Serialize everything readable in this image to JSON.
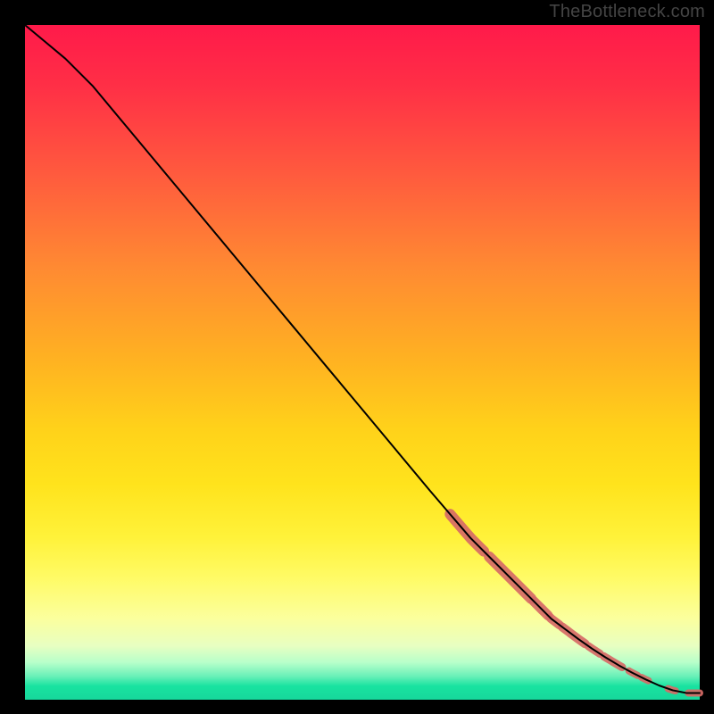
{
  "watermark": "TheBottleneck.com",
  "colors": {
    "background": "#000000",
    "curve": "#000000",
    "highlight": "#d66a66"
  },
  "chart_data": {
    "type": "line",
    "title": "",
    "xlabel": "",
    "ylabel": "",
    "xlim": [
      0,
      100
    ],
    "ylim": [
      0,
      100
    ],
    "grid": false,
    "legend": false,
    "series": [
      {
        "name": "bottleneck-curve",
        "x": [
          0,
          3,
          6,
          10,
          15,
          20,
          25,
          30,
          35,
          40,
          45,
          50,
          55,
          60,
          63,
          66,
          69,
          72,
          75,
          78,
          80,
          82,
          84,
          86,
          88,
          90,
          92,
          94,
          96,
          98,
          100
        ],
        "y": [
          100,
          97.5,
          95,
          91,
          85,
          79,
          73,
          67,
          61,
          55,
          49,
          43,
          37,
          31,
          27.5,
          24,
          21,
          18,
          15,
          12,
          10.5,
          9,
          7.6,
          6.3,
          5.1,
          4.0,
          3.0,
          2.1,
          1.4,
          1.0,
          1.0
        ]
      }
    ],
    "highlight_segments": [
      {
        "x0": 63,
        "x1": 68,
        "thickness": 12
      },
      {
        "x0": 68.8,
        "x1": 75,
        "thickness": 12
      },
      {
        "x0": 75.4,
        "x1": 77.5,
        "thickness": 11
      },
      {
        "x0": 77.8,
        "x1": 79.2,
        "thickness": 10
      },
      {
        "x0": 79.6,
        "x1": 83.0,
        "thickness": 10
      },
      {
        "x0": 83.5,
        "x1": 85.2,
        "thickness": 9
      },
      {
        "x0": 85.8,
        "x1": 88.5,
        "thickness": 9
      },
      {
        "x0": 89.5,
        "x1": 90.8,
        "thickness": 8
      },
      {
        "x0": 91.4,
        "x1": 92.4,
        "thickness": 8
      },
      {
        "x0": 95.3,
        "x1": 96.4,
        "thickness": 8
      },
      {
        "x0": 98.3,
        "x1": 100,
        "thickness": 8
      }
    ]
  }
}
